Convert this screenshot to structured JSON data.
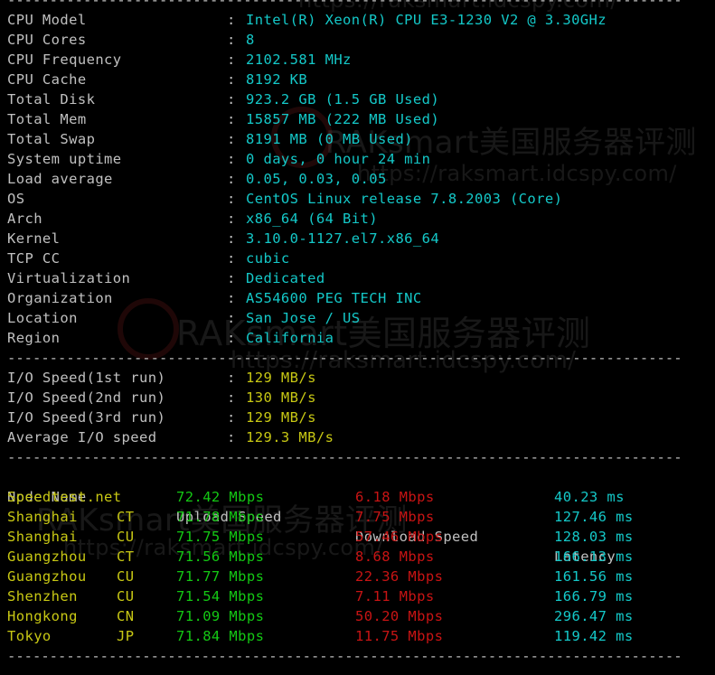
{
  "separator": "--------------------------------------------------------------------------------",
  "watermark": {
    "brand_line": "RAKsmart美国服务器评测",
    "url_line": "https://raksmart.idcspy.com/",
    "top_line": "https://raksmart.idcspy.com/"
  },
  "sysinfo": [
    {
      "key": "CPU Model",
      "value": "Intel(R) Xeon(R) CPU E3-1230 V2 @ 3.30GHz"
    },
    {
      "key": "CPU Cores",
      "value": "8"
    },
    {
      "key": "CPU Frequency",
      "value": "2102.581 MHz"
    },
    {
      "key": "CPU Cache",
      "value": "8192 KB"
    },
    {
      "key": "Total Disk",
      "value": "923.2 GB (1.5 GB Used)"
    },
    {
      "key": "Total Mem",
      "value": "15857 MB (222 MB Used)"
    },
    {
      "key": "Total Swap",
      "value": "8191 MB (0 MB Used)"
    },
    {
      "key": "System uptime",
      "value": "0 days, 0 hour 24 min"
    },
    {
      "key": "Load average",
      "value": "0.05, 0.03, 0.05"
    },
    {
      "key": "OS",
      "value": "CentOS Linux release 7.8.2003 (Core)"
    },
    {
      "key": "Arch",
      "value": "x86_64 (64 Bit)"
    },
    {
      "key": "Kernel",
      "value": "3.10.0-1127.el7.x86_64"
    },
    {
      "key": "TCP CC",
      "value": "cubic"
    },
    {
      "key": "Virtualization",
      "value": "Dedicated"
    },
    {
      "key": "Organization",
      "value": "AS54600 PEG TECH INC"
    },
    {
      "key": "Location",
      "value": "San Jose / US"
    },
    {
      "key": "Region",
      "value": "California"
    }
  ],
  "io": [
    {
      "key": "I/O Speed(1st run)",
      "value": "129 MB/s"
    },
    {
      "key": "I/O Speed(2nd run)",
      "value": "130 MB/s"
    },
    {
      "key": "I/O Speed(3rd run)",
      "value": "129 MB/s"
    },
    {
      "key": "Average I/O speed",
      "value": "129.3 MB/s"
    }
  ],
  "speedtest": {
    "headers": {
      "node": "Node Name",
      "upload": "Upload Speed",
      "download": "Download Speed",
      "latency": "Latency"
    },
    "rows": [
      {
        "node": "Speedtest.net",
        "isp": "",
        "upload": "72.42 Mbps",
        "download": "6.18 Mbps",
        "latency": "40.23 ms"
      },
      {
        "node": "Shanghai",
        "isp": "CT",
        "upload": "71.78 Mbps",
        "download": "7.75 Mbps",
        "latency": "127.46 ms"
      },
      {
        "node": "Shanghai",
        "isp": "CU",
        "upload": "71.75 Mbps",
        "download": "57.46 Mbps",
        "latency": "128.03 ms"
      },
      {
        "node": "Guangzhou",
        "isp": "CT",
        "upload": "71.56 Mbps",
        "download": "8.68 Mbps",
        "latency": "166.13 ms"
      },
      {
        "node": "Guangzhou",
        "isp": "CU",
        "upload": "71.77 Mbps",
        "download": "22.36 Mbps",
        "latency": "161.56 ms"
      },
      {
        "node": "Shenzhen",
        "isp": "CU",
        "upload": "71.54 Mbps",
        "download": "7.11 Mbps",
        "latency": "166.79 ms"
      },
      {
        "node": "Hongkong",
        "isp": "CN",
        "upload": "71.09 Mbps",
        "download": "50.20 Mbps",
        "latency": "296.47 ms"
      },
      {
        "node": "Tokyo",
        "isp": "JP",
        "upload": "71.84 Mbps",
        "download": "11.75 Mbps",
        "latency": "119.42 ms"
      }
    ]
  },
  "colors": {
    "background": "#000000",
    "label": "#c0c0c0",
    "value_cyan": "#14c8c8",
    "value_yellow": "#c8c814",
    "upload_green": "#14c814",
    "download_red": "#c81414"
  }
}
